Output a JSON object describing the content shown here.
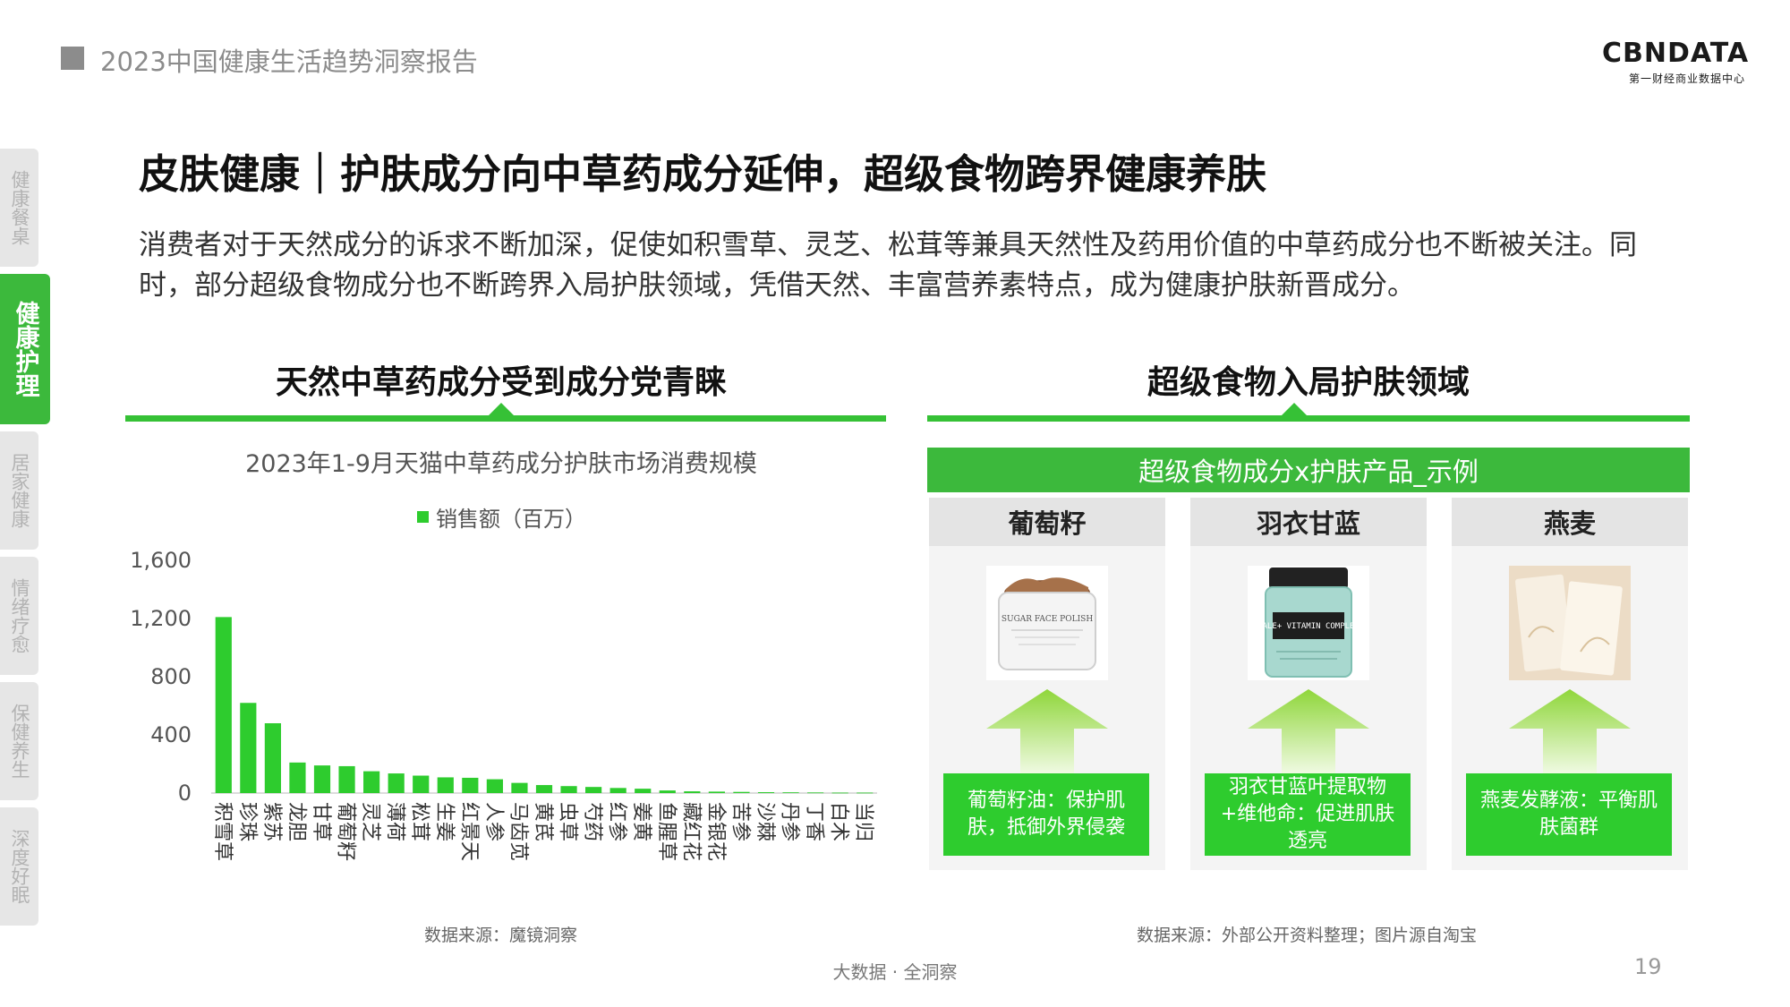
{
  "header": {
    "report_title": "2023中国健康生活趋势洞察报告",
    "logo_main": "CBNDATA",
    "logo_sub": "第一财经商业数据中心"
  },
  "sidenav": [
    {
      "label": "健康餐桌",
      "active": false
    },
    {
      "label": "健康护理",
      "active": true
    },
    {
      "label": "居家健康",
      "active": false
    },
    {
      "label": "情绪疗愈",
      "active": false
    },
    {
      "label": "保健养生",
      "active": false
    },
    {
      "label": "深度好眠",
      "active": false
    }
  ],
  "main": {
    "title": "皮肤健康｜护肤成分向中草药成分延伸，超级食物跨界健康养肤",
    "intro": "消费者对于天然成分的诉求不断加深，促使如积雪草、灵芝、松茸等兼具天然性及药用价值的中草药成分也不断被关注。同时，部分超级食物成分也不断跨界入局护肤领域，凭借天然、丰富营养素特点，成为健康护肤新晋成分。"
  },
  "left_section": {
    "title": "天然中草药成分受到成分党青睐",
    "chart_title": "2023年1-9月天猫中草药成分护肤市场消费规模",
    "source": "数据来源：魔镜洞察"
  },
  "chart_data": {
    "type": "bar",
    "title": "2023年1-9月天猫中草药成分护肤市场消费规模",
    "series": [
      {
        "name": "销售额（百万）",
        "color": "#2ecc2e",
        "values": [
          1210,
          620,
          480,
          210,
          190,
          185,
          150,
          135,
          120,
          108,
          105,
          95,
          70,
          55,
          48,
          42,
          35,
          30,
          18,
          12,
          10,
          8,
          6,
          5,
          4,
          3,
          3
        ]
      }
    ],
    "categories": [
      "积雪草",
      "珍珠",
      "紫苏",
      "龙胆",
      "甘草",
      "葡萄籽",
      "灵芝",
      "薄荷",
      "松茸",
      "生姜",
      "红景天",
      "人参",
      "马齿苋",
      "黄芪",
      "虫草",
      "芍药",
      "红参",
      "姜黄",
      "鱼腥草",
      "藏红花",
      "金银花",
      "苦参",
      "沙棘",
      "丹参",
      "丁香",
      "白术",
      "当归"
    ],
    "yticks": [
      "0",
      "400",
      "800",
      "1,200",
      "1,600"
    ],
    "ylim": [
      0,
      1600
    ],
    "legend": "top",
    "grid": false
  },
  "right_section": {
    "title": "超级食物入局护肤领域",
    "banner": "超级食物成分x护肤产品_示例",
    "source": "数据来源：外部公开资料整理；图片源自淘宝",
    "cards": [
      {
        "name": "葡萄籽",
        "product_label": "SUGAR FACE POLISH",
        "desc": "葡萄籽油：保护肌肤，抵御外界侵袭"
      },
      {
        "name": "羽衣甘蓝",
        "product_label": "KALE+ VITAMIN COMPLEX",
        "desc": "羽衣甘蓝叶提取物+维他命：促进肌肤透亮"
      },
      {
        "name": "燕麦",
        "desc": "燕麦发酵液：平衡肌肤菌群"
      }
    ]
  },
  "footer": {
    "slogan": "大数据 · 全洞察",
    "page_number": "19"
  },
  "colors": {
    "accent_green": "#3cb93c",
    "bar_green": "#2ecc2e",
    "gray_text": "#8c8c8c"
  }
}
